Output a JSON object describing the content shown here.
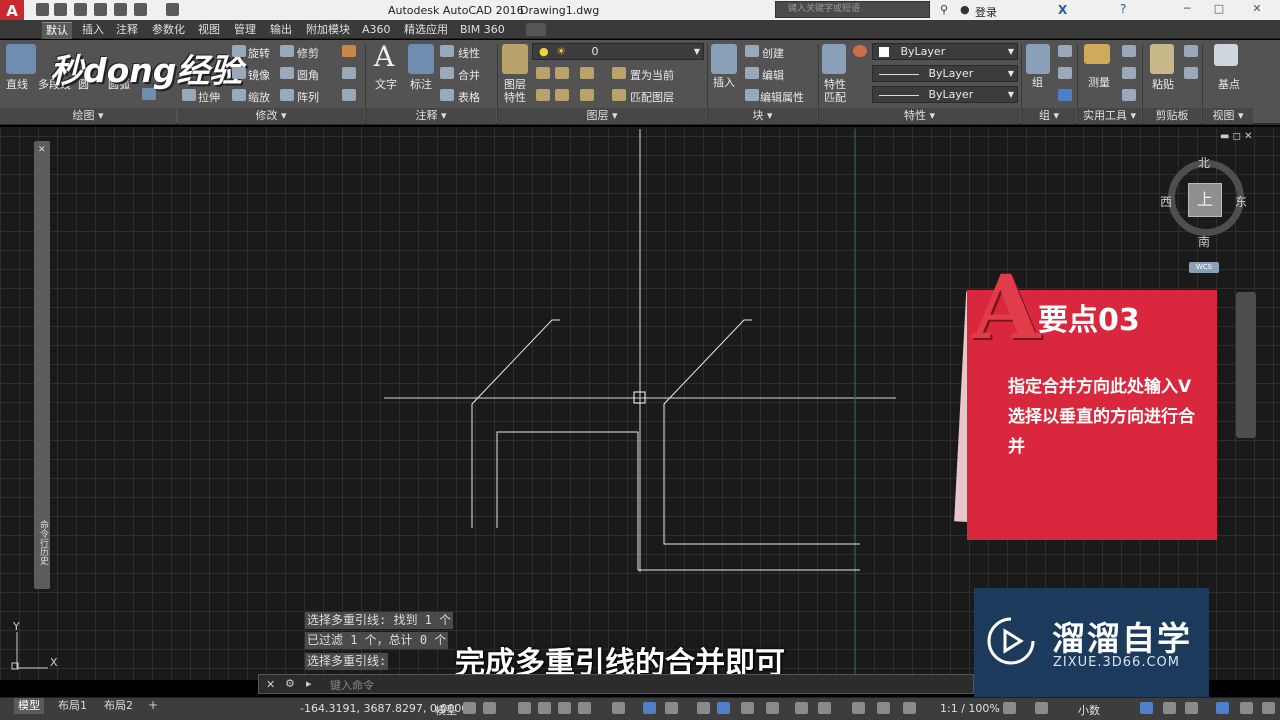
{
  "titlebar": {
    "app_title": "Autodesk AutoCAD 2016",
    "doc_title": "Drawing1.dwg",
    "search_placeholder": "键入关键字或短语",
    "login": "登录"
  },
  "ribbon_tabs": [
    "默认",
    "插入",
    "注释",
    "参数化",
    "视图",
    "管理",
    "输出",
    "附加模块",
    "A360",
    "精选应用",
    "BIM 360"
  ],
  "ribbon": {
    "draw": {
      "line": "直线",
      "polyline": "多段线",
      "circle": "圆",
      "arc": "圆弧",
      "panel": "绘图"
    },
    "modify": {
      "rotate": "旋转",
      "trim": "修剪",
      "mirror": "镜像",
      "fillet": "圆角",
      "stretch": "拉伸",
      "scale": "缩放",
      "array": "阵列",
      "panel": "修改"
    },
    "annotation": {
      "text": "文字",
      "dimension": "标注",
      "linear": "线性",
      "merge": "合并",
      "table": "表格",
      "panel": "注释"
    },
    "layers": {
      "layer_props": "图层",
      "layer_props2": "特性",
      "current_layer": "0",
      "set_current": "置为当前",
      "match_layer": "匹配图层",
      "panel": "图层"
    },
    "block": {
      "insert": "插入",
      "create": "创建",
      "edit": "编辑",
      "edit_attr": "编辑属性",
      "panel": "块"
    },
    "properties": {
      "match": "特性",
      "match2": "匹配",
      "color": "ByLayer",
      "linetype": "ByLayer",
      "lineweight": "ByLayer",
      "panel": "特性"
    },
    "groups": {
      "group": "组",
      "panel": "组"
    },
    "utilities": {
      "measure": "测量",
      "panel": "实用工具"
    },
    "clipboard": {
      "paste": "粘贴",
      "panel": "剪贴板"
    },
    "view": {
      "base": "基点",
      "panel": "视图"
    }
  },
  "overlay_logo": "秒dong经验",
  "viewcube": {
    "north": "北",
    "south": "南",
    "east": "东",
    "west": "西",
    "top": "上",
    "wcs": "WCS"
  },
  "left_palette_label": "命令行历史",
  "card": {
    "number_title": "要点03",
    "body": "指定合并方向此处输入V选择以垂直的方向进行合并"
  },
  "command_history": [
    "选择多重引线: 找到 1 个",
    "已过滤 1 个，总计 0 个",
    "选择多重引线:"
  ],
  "command_placeholder": "键入命令",
  "subtitle": "完成多重引线的合并即可",
  "brand": {
    "name": "溜溜自学",
    "url": "ZIXUE.3D66.COM"
  },
  "layout_tabs": [
    "模型",
    "布局1",
    "布局2"
  ],
  "status": {
    "coords": "-164.3191, 3687.8297, 0.0000",
    "model": "模型",
    "scale": "1:1 / 100%",
    "units": "小数"
  },
  "ucs": {
    "x": "X",
    "y": "Y"
  },
  "colors": {
    "accent_red": "#d9273d",
    "brand_blue": "#1b3a5c",
    "grid": "#2e2e2e"
  }
}
